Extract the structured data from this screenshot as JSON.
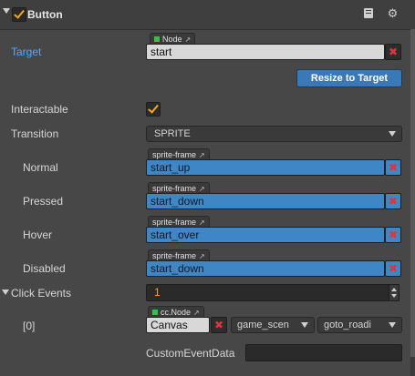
{
  "header": {
    "title": "Button",
    "enabled": true,
    "icons": [
      "chevron-down-icon",
      "book-icon",
      "gear-icon"
    ]
  },
  "target": {
    "label": "Target",
    "tag": "Node",
    "value": "start"
  },
  "resize_button": "Resize to Target",
  "interactable": {
    "label": "Interactable",
    "checked": true
  },
  "transition": {
    "label": "Transition",
    "value": "SPRITE"
  },
  "sprites": [
    {
      "label": "Normal",
      "tag": "sprite-frame",
      "value": "start_up"
    },
    {
      "label": "Pressed",
      "tag": "sprite-frame",
      "value": "start_down"
    },
    {
      "label": "Hover",
      "tag": "sprite-frame",
      "value": "start_over"
    },
    {
      "label": "Disabled",
      "tag": "sprite-frame",
      "value": "start_down"
    }
  ],
  "click_events": {
    "label": "Click Events",
    "count": "1",
    "item": {
      "index_label": "[0]",
      "tag": "cc.Node",
      "node": "Canvas",
      "component": "game_scen",
      "handler": "goto_roadi",
      "custom_label": "CustomEventData",
      "custom_value": ""
    }
  },
  "colors": {
    "panel_bg": "#474747",
    "accent": "#f5a623",
    "target_label": "#4ea8ff",
    "sprite_field": "#3f86c6",
    "remove": "#e0343a"
  }
}
